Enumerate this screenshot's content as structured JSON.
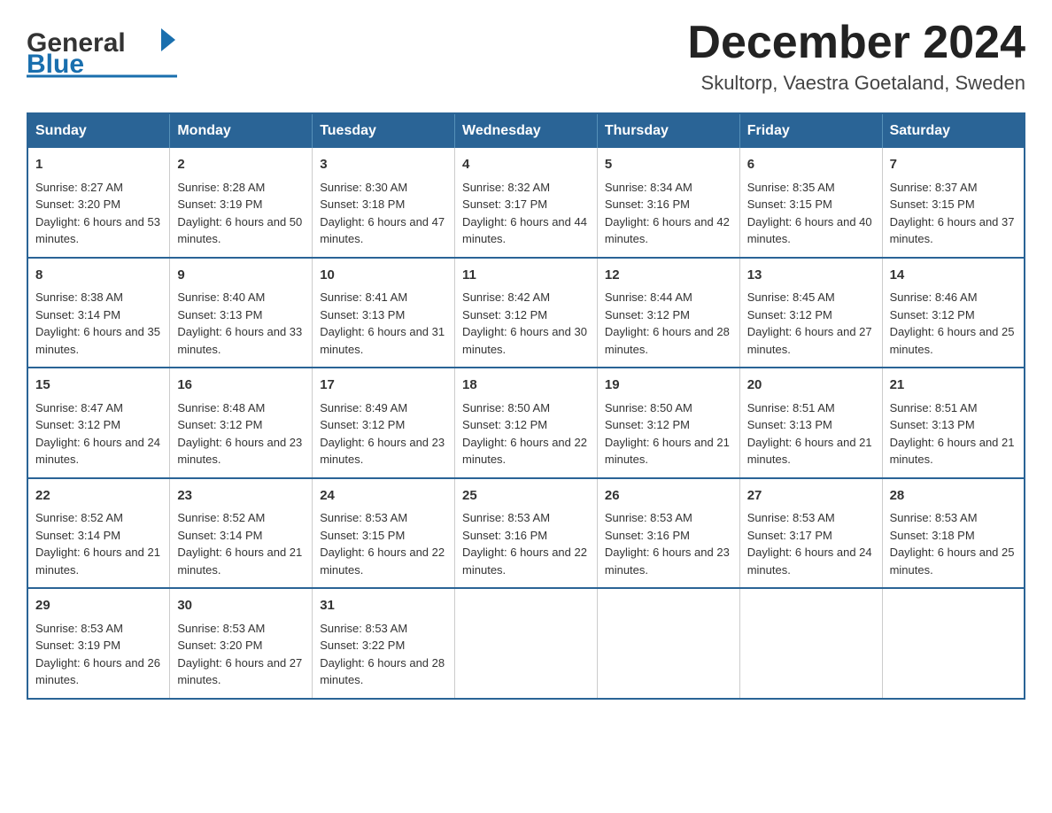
{
  "header": {
    "logo_general": "General",
    "logo_blue": "Blue",
    "title": "December 2024",
    "location": "Skultorp, Vaestra Goetaland, Sweden"
  },
  "calendar": {
    "days_of_week": [
      "Sunday",
      "Monday",
      "Tuesday",
      "Wednesday",
      "Thursday",
      "Friday",
      "Saturday"
    ],
    "weeks": [
      [
        {
          "day": "1",
          "sunrise": "Sunrise: 8:27 AM",
          "sunset": "Sunset: 3:20 PM",
          "daylight": "Daylight: 6 hours and 53 minutes."
        },
        {
          "day": "2",
          "sunrise": "Sunrise: 8:28 AM",
          "sunset": "Sunset: 3:19 PM",
          "daylight": "Daylight: 6 hours and 50 minutes."
        },
        {
          "day": "3",
          "sunrise": "Sunrise: 8:30 AM",
          "sunset": "Sunset: 3:18 PM",
          "daylight": "Daylight: 6 hours and 47 minutes."
        },
        {
          "day": "4",
          "sunrise": "Sunrise: 8:32 AM",
          "sunset": "Sunset: 3:17 PM",
          "daylight": "Daylight: 6 hours and 44 minutes."
        },
        {
          "day": "5",
          "sunrise": "Sunrise: 8:34 AM",
          "sunset": "Sunset: 3:16 PM",
          "daylight": "Daylight: 6 hours and 42 minutes."
        },
        {
          "day": "6",
          "sunrise": "Sunrise: 8:35 AM",
          "sunset": "Sunset: 3:15 PM",
          "daylight": "Daylight: 6 hours and 40 minutes."
        },
        {
          "day": "7",
          "sunrise": "Sunrise: 8:37 AM",
          "sunset": "Sunset: 3:15 PM",
          "daylight": "Daylight: 6 hours and 37 minutes."
        }
      ],
      [
        {
          "day": "8",
          "sunrise": "Sunrise: 8:38 AM",
          "sunset": "Sunset: 3:14 PM",
          "daylight": "Daylight: 6 hours and 35 minutes."
        },
        {
          "day": "9",
          "sunrise": "Sunrise: 8:40 AM",
          "sunset": "Sunset: 3:13 PM",
          "daylight": "Daylight: 6 hours and 33 minutes."
        },
        {
          "day": "10",
          "sunrise": "Sunrise: 8:41 AM",
          "sunset": "Sunset: 3:13 PM",
          "daylight": "Daylight: 6 hours and 31 minutes."
        },
        {
          "day": "11",
          "sunrise": "Sunrise: 8:42 AM",
          "sunset": "Sunset: 3:12 PM",
          "daylight": "Daylight: 6 hours and 30 minutes."
        },
        {
          "day": "12",
          "sunrise": "Sunrise: 8:44 AM",
          "sunset": "Sunset: 3:12 PM",
          "daylight": "Daylight: 6 hours and 28 minutes."
        },
        {
          "day": "13",
          "sunrise": "Sunrise: 8:45 AM",
          "sunset": "Sunset: 3:12 PM",
          "daylight": "Daylight: 6 hours and 27 minutes."
        },
        {
          "day": "14",
          "sunrise": "Sunrise: 8:46 AM",
          "sunset": "Sunset: 3:12 PM",
          "daylight": "Daylight: 6 hours and 25 minutes."
        }
      ],
      [
        {
          "day": "15",
          "sunrise": "Sunrise: 8:47 AM",
          "sunset": "Sunset: 3:12 PM",
          "daylight": "Daylight: 6 hours and 24 minutes."
        },
        {
          "day": "16",
          "sunrise": "Sunrise: 8:48 AM",
          "sunset": "Sunset: 3:12 PM",
          "daylight": "Daylight: 6 hours and 23 minutes."
        },
        {
          "day": "17",
          "sunrise": "Sunrise: 8:49 AM",
          "sunset": "Sunset: 3:12 PM",
          "daylight": "Daylight: 6 hours and 23 minutes."
        },
        {
          "day": "18",
          "sunrise": "Sunrise: 8:50 AM",
          "sunset": "Sunset: 3:12 PM",
          "daylight": "Daylight: 6 hours and 22 minutes."
        },
        {
          "day": "19",
          "sunrise": "Sunrise: 8:50 AM",
          "sunset": "Sunset: 3:12 PM",
          "daylight": "Daylight: 6 hours and 21 minutes."
        },
        {
          "day": "20",
          "sunrise": "Sunrise: 8:51 AM",
          "sunset": "Sunset: 3:13 PM",
          "daylight": "Daylight: 6 hours and 21 minutes."
        },
        {
          "day": "21",
          "sunrise": "Sunrise: 8:51 AM",
          "sunset": "Sunset: 3:13 PM",
          "daylight": "Daylight: 6 hours and 21 minutes."
        }
      ],
      [
        {
          "day": "22",
          "sunrise": "Sunrise: 8:52 AM",
          "sunset": "Sunset: 3:14 PM",
          "daylight": "Daylight: 6 hours and 21 minutes."
        },
        {
          "day": "23",
          "sunrise": "Sunrise: 8:52 AM",
          "sunset": "Sunset: 3:14 PM",
          "daylight": "Daylight: 6 hours and 21 minutes."
        },
        {
          "day": "24",
          "sunrise": "Sunrise: 8:53 AM",
          "sunset": "Sunset: 3:15 PM",
          "daylight": "Daylight: 6 hours and 22 minutes."
        },
        {
          "day": "25",
          "sunrise": "Sunrise: 8:53 AM",
          "sunset": "Sunset: 3:16 PM",
          "daylight": "Daylight: 6 hours and 22 minutes."
        },
        {
          "day": "26",
          "sunrise": "Sunrise: 8:53 AM",
          "sunset": "Sunset: 3:16 PM",
          "daylight": "Daylight: 6 hours and 23 minutes."
        },
        {
          "day": "27",
          "sunrise": "Sunrise: 8:53 AM",
          "sunset": "Sunset: 3:17 PM",
          "daylight": "Daylight: 6 hours and 24 minutes."
        },
        {
          "day": "28",
          "sunrise": "Sunrise: 8:53 AM",
          "sunset": "Sunset: 3:18 PM",
          "daylight": "Daylight: 6 hours and 25 minutes."
        }
      ],
      [
        {
          "day": "29",
          "sunrise": "Sunrise: 8:53 AM",
          "sunset": "Sunset: 3:19 PM",
          "daylight": "Daylight: 6 hours and 26 minutes."
        },
        {
          "day": "30",
          "sunrise": "Sunrise: 8:53 AM",
          "sunset": "Sunset: 3:20 PM",
          "daylight": "Daylight: 6 hours and 27 minutes."
        },
        {
          "day": "31",
          "sunrise": "Sunrise: 8:53 AM",
          "sunset": "Sunset: 3:22 PM",
          "daylight": "Daylight: 6 hours and 28 minutes."
        },
        null,
        null,
        null,
        null
      ]
    ]
  }
}
